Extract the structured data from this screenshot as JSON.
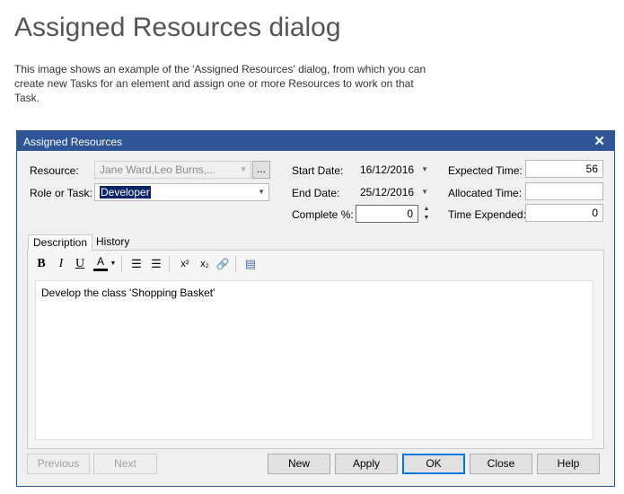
{
  "page": {
    "title": "Assigned Resources dialog",
    "description": "This image shows an example of the 'Assigned Resources' dialog, from which you can create new Tasks for an element and assign one or more Resources to work on that Task."
  },
  "dialog": {
    "title": "Assigned Resources",
    "close_glyph": "✕",
    "resource": {
      "label": "Resource:",
      "value": "Jane Ward,Leo Burns,...",
      "browse_label": "..."
    },
    "role": {
      "label": "Role or Task:",
      "value": "Developer"
    },
    "start_date": {
      "label": "Start Date:",
      "value": "16/12/2016"
    },
    "end_date": {
      "label": "End Date:",
      "value": "25/12/2016"
    },
    "complete": {
      "label": "Complete %:",
      "value": "0"
    },
    "expected_time": {
      "label": "Expected Time:",
      "value": "56"
    },
    "allocated_time": {
      "label": "Allocated Time:",
      "value": ""
    },
    "time_expended": {
      "label": "Time Expended:",
      "value": "0"
    },
    "tabs": [
      {
        "label": "Description"
      },
      {
        "label": "History"
      }
    ],
    "toolbar": {
      "bold": "B",
      "italic": "I",
      "underline": "U",
      "color": "A",
      "bullets": "☰",
      "numbers": "☰",
      "superscript": "x²",
      "subscript": "x₂",
      "hyperlink": "🔗",
      "note": "▤"
    },
    "description_text": "Develop the class 'Shopping Basket'",
    "buttons": {
      "previous": "Previous",
      "next": "Next",
      "new": "New",
      "apply": "Apply",
      "ok": "OK",
      "close": "Close",
      "help": "Help"
    }
  }
}
